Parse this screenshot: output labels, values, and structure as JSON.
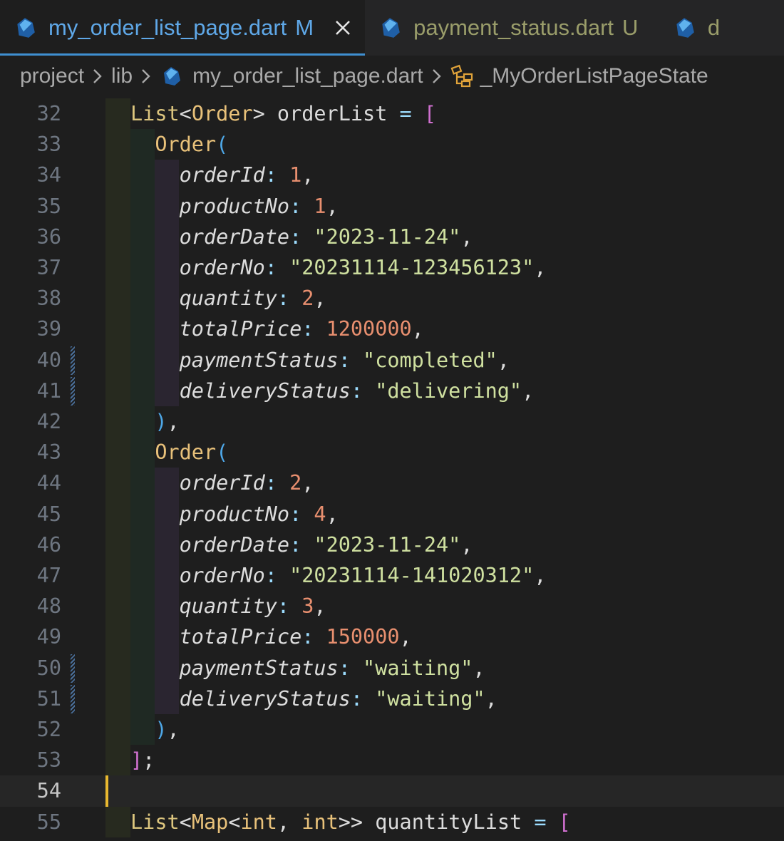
{
  "tabs": [
    {
      "name": "my_order_list_page.dart",
      "flag": "M",
      "active": true
    },
    {
      "name": "payment_status.dart",
      "flag": "U",
      "active": false
    },
    {
      "name": "d",
      "flag": "",
      "active": false
    }
  ],
  "breadcrumb": {
    "items": [
      "project",
      "lib",
      "my_order_list_page.dart",
      "_MyOrderListPageState"
    ]
  },
  "colors": {
    "editor_bg": "#1e1e1e",
    "tab_bg": "#252526",
    "active_tab_text": "#5fa8e8",
    "untracked_text": "#9a9d6a",
    "cursor": "#e8b82f",
    "string": "#cfe0a0",
    "number": "#e88f6f",
    "type": "#dcc57e"
  },
  "editor": {
    "current_line": 54,
    "lines": [
      {
        "n": "32",
        "type": "decl",
        "t1": "List",
        "t2": "<",
        "t3": "Order",
        "t4": "> orderList ",
        "t5": "=",
        "t6": " ["
      },
      {
        "n": "33",
        "type": "ctor",
        "name": "Order",
        "paren": "("
      },
      {
        "n": "34",
        "type": "prop",
        "key": "orderId",
        "val": "1",
        "vtype": "num"
      },
      {
        "n": "35",
        "type": "prop",
        "key": "productNo",
        "val": "1",
        "vtype": "num"
      },
      {
        "n": "36",
        "type": "prop",
        "key": "orderDate",
        "val": "\"2023-11-24\"",
        "vtype": "str"
      },
      {
        "n": "37",
        "type": "prop",
        "key": "orderNo",
        "val": "\"20231114-123456123\"",
        "vtype": "str"
      },
      {
        "n": "38",
        "type": "prop",
        "key": "quantity",
        "val": "2",
        "vtype": "num"
      },
      {
        "n": "39",
        "type": "prop",
        "key": "totalPrice",
        "val": "1200000",
        "vtype": "num"
      },
      {
        "n": "40",
        "type": "prop",
        "key": "paymentStatus",
        "val": "\"completed\"",
        "vtype": "str",
        "mark": true
      },
      {
        "n": "41",
        "type": "prop",
        "key": "deliveryStatus",
        "val": "\"delivering\"",
        "vtype": "str",
        "mark": true
      },
      {
        "n": "42",
        "type": "close",
        "text": ")"
      },
      {
        "n": "43",
        "type": "ctor",
        "name": "Order",
        "paren": "("
      },
      {
        "n": "44",
        "type": "prop",
        "key": "orderId",
        "val": "2",
        "vtype": "num"
      },
      {
        "n": "45",
        "type": "prop",
        "key": "productNo",
        "val": "4",
        "vtype": "num"
      },
      {
        "n": "46",
        "type": "prop",
        "key": "orderDate",
        "val": "\"2023-11-24\"",
        "vtype": "str"
      },
      {
        "n": "47",
        "type": "prop",
        "key": "orderNo",
        "val": "\"20231114-141020312\"",
        "vtype": "str"
      },
      {
        "n": "48",
        "type": "prop",
        "key": "quantity",
        "val": "3",
        "vtype": "num"
      },
      {
        "n": "49",
        "type": "prop",
        "key": "totalPrice",
        "val": "150000",
        "vtype": "num"
      },
      {
        "n": "50",
        "type": "prop",
        "key": "paymentStatus",
        "val": "\"waiting\"",
        "vtype": "str",
        "mark": true
      },
      {
        "n": "51",
        "type": "prop",
        "key": "deliveryStatus",
        "val": "\"waiting\"",
        "vtype": "str",
        "mark": true
      },
      {
        "n": "52",
        "type": "close",
        "text": ")"
      },
      {
        "n": "53",
        "type": "end",
        "text": "]"
      },
      {
        "n": "54",
        "type": "empty"
      },
      {
        "n": "55",
        "type": "decl2",
        "a": "List",
        "b": "<",
        "c": "Map",
        "d": "<",
        "e": "int",
        "f": ", ",
        "g": "int",
        "h": ">> quantityList ",
        "i": "=",
        "j": " ["
      }
    ]
  }
}
